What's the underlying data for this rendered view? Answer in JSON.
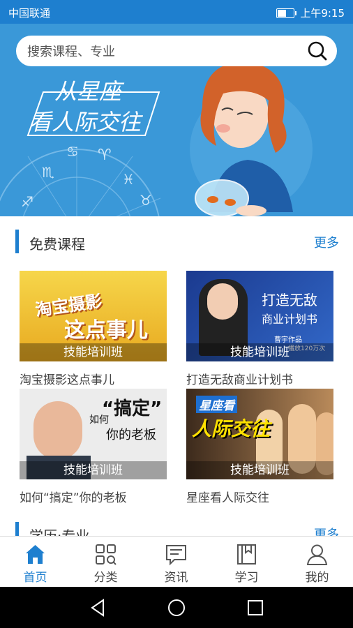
{
  "status": {
    "carrier": "中国联通",
    "time": "上午9:15",
    "battery_level": 0.5
  },
  "search": {
    "placeholder": "搜索课程、专业"
  },
  "banner": {
    "line1": "从星座",
    "line2": "看人际交往"
  },
  "free_courses": {
    "title": "免费课程",
    "more": "更多",
    "courses": [
      {
        "title": "淘宝摄影这点事儿",
        "tag": "技能培训班",
        "thumb_line1": "淘宝摄影",
        "thumb_line2": "这点事儿"
      },
      {
        "title": "打造无敌商业计划书",
        "tag": "技能培训班",
        "thumb_line1": "打造无敌",
        "thumb_line2": "商业计划书",
        "thumb_small1": "曹宇作品",
        "thumb_small2": "播放120万次"
      },
      {
        "title": "如何“搞定”你的老板",
        "tag": "技能培训班",
        "thumb_line0": "如何",
        "thumb_line1": "“搞定”",
        "thumb_line2": "你的老板"
      },
      {
        "title": "星座看人际交往",
        "tag": "技能培训班",
        "thumb_line1": "星座看",
        "thumb_line2": "人际交往"
      }
    ]
  },
  "next_section": {
    "title": "学历·专业",
    "more": "更多"
  },
  "tabs": [
    {
      "label": "首页",
      "icon": "home-icon",
      "active": true
    },
    {
      "label": "分类",
      "icon": "category-icon",
      "active": false
    },
    {
      "label": "资讯",
      "icon": "news-icon",
      "active": false
    },
    {
      "label": "学习",
      "icon": "book-icon",
      "active": false
    },
    {
      "label": "我的",
      "icon": "profile-icon",
      "active": false
    }
  ],
  "colors": {
    "primary": "#1e7fcf",
    "banner": "#3a98d8"
  }
}
